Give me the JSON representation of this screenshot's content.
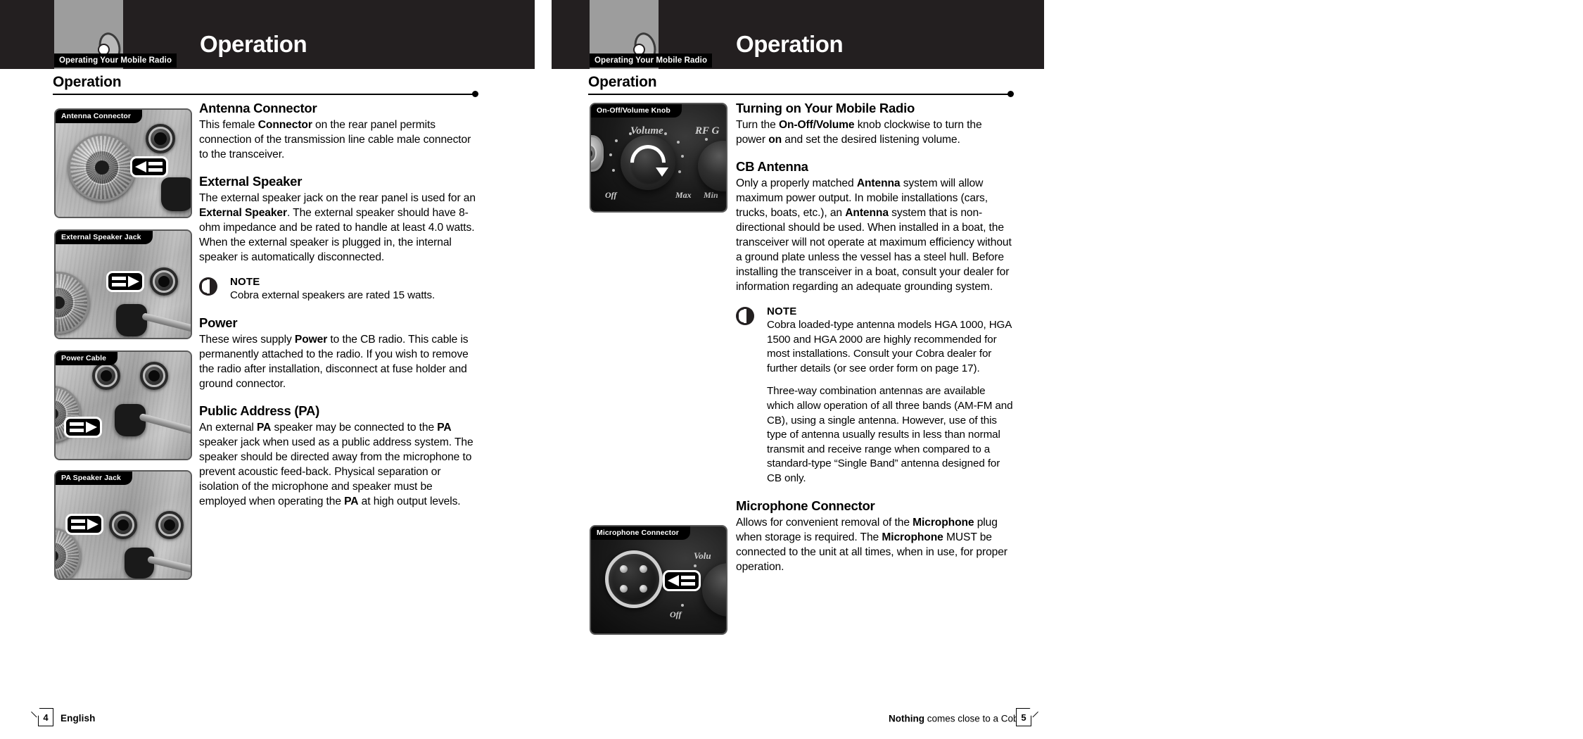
{
  "document": {
    "header_title": "Operation",
    "header_tab": "Operating Your Mobile Radio",
    "section_title": "Operation"
  },
  "left_page": {
    "panels": [
      {
        "caption": "Antenna Connector",
        "arrow_direction": "left"
      },
      {
        "caption": "External Speaker Jack",
        "arrow_direction": "right"
      },
      {
        "caption": "Power Cable",
        "arrow_direction": "right"
      },
      {
        "caption": "PA Speaker Jack",
        "arrow_direction": "right"
      }
    ],
    "sections": {
      "antenna_connector": {
        "heading": "Antenna Connector",
        "body_1": "This female ",
        "body_1_b": "Connector",
        "body_2": " on the rear panel permits connection of the transmission line cable male connector to the transceiver."
      },
      "external_speaker": {
        "heading": "External Speaker",
        "body_1": "The external speaker jack on the rear panel is used for an ",
        "body_1_b": "External Speaker",
        "body_2": ". The external speaker should have 8-ohm impedance and be rated to handle at least 4.0 watts. When the external speaker is plugged in, the internal speaker is automatically disconnected."
      },
      "note_speaker": {
        "title": "NOTE",
        "text": "Cobra external speakers are rated 15 watts."
      },
      "power": {
        "heading": "Power",
        "body_1": "These wires supply ",
        "body_1_b": "Power",
        "body_2": " to the CB radio. This cable is permanently attached to the radio. If you wish to remove the radio after installation, disconnect at fuse holder and ground connector."
      },
      "public_address": {
        "heading": "Public Address (PA)",
        "body_1": "An external ",
        "body_1_b": "PA",
        "body_2": " speaker may be connected to the ",
        "body_2_b": "PA",
        "body_3": " speaker jack when used as a public address system. The speaker should be directed away from the microphone to prevent acoustic feed-back. Physical separation or isolation of the microphone and speaker must be employed when operating the ",
        "body_3_b": "PA",
        "body_4": " at high output levels."
      }
    },
    "footer": {
      "page_number": "4",
      "language": "English"
    }
  },
  "right_page": {
    "panels": [
      {
        "caption": "On-Off/Volume Knob",
        "labels": {
          "volume": "Volume",
          "rf": "RF G",
          "off": "Off",
          "max": "Max",
          "min": "Min"
        }
      },
      {
        "caption": "Microphone Connector",
        "labels": {
          "volume": "Volu",
          "off": "Off"
        },
        "arrow_direction": "left"
      }
    ],
    "sections": {
      "turning_on": {
        "heading": "Turning on Your Mobile Radio",
        "body_1": "Turn the ",
        "body_1_b": "On-Off/Volume",
        "body_2": " knob clockwise to turn the power ",
        "body_2_b": "on",
        "body_3": " and set the desired listening volume."
      },
      "cb_antenna": {
        "heading": "CB Antenna",
        "body_1": "Only a properly matched ",
        "body_1_b": "Antenna",
        "body_2": " system will allow maximum power output. In mobile installations (cars, trucks, boats, etc.), an ",
        "body_2_b": "Antenna",
        "body_3": " system that is non-directional should be used. When installed in a boat, the transceiver will not operate at maximum efficiency without a ground plate unless the vessel has a steel hull. Before installing the transceiver in a boat, consult your dealer for information regarding an adequate grounding system."
      },
      "note_antenna": {
        "title": "NOTE",
        "text_1": "Cobra loaded-type antenna models HGA 1000, HGA 1500 and HGA 2000 are highly recommended for most installations. Consult your Cobra dealer for further details (or see order form on page 17).",
        "text_2": "Three-way combination antennas are available which allow operation of all three bands (AM-FM and CB), using a single antenna. However, use of this type of antenna usually results in less than normal transmit and receive range when compared to a standard-type “Single Band” antenna designed for CB only."
      },
      "microphone_connector": {
        "heading": "Microphone Connector",
        "body_1": "Allows for convenient removal of the ",
        "body_1_b": "Microphone",
        "body_2": " plug when storage is required. The ",
        "body_2_b": "Microphone",
        "body_3": " MUST be connected to the unit at all times, when in use, for proper operation."
      }
    },
    "footer": {
      "page_number": "5",
      "tagline_bold": "Nothing",
      "tagline_rest": " comes close to a Cobra",
      "tagline_sup": "®"
    }
  },
  "colors": {
    "header_dark": "#231f20",
    "logo_gray": "#9d9d9d",
    "tab_black": "#000000",
    "text_black": "#000000",
    "paper_white": "#ffffff"
  }
}
